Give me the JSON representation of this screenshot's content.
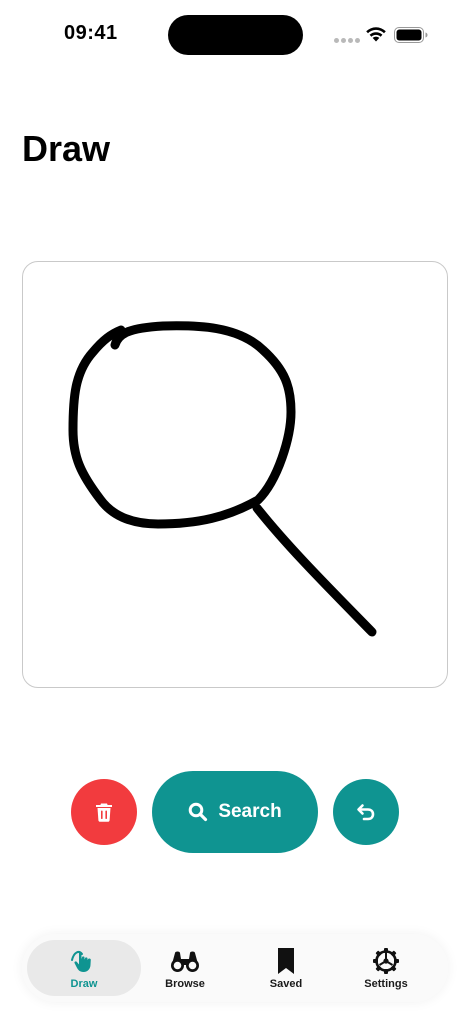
{
  "status_bar": {
    "time": "09:41"
  },
  "page": {
    "title": "Draw"
  },
  "actions": {
    "delete_icon": "trash-icon",
    "search_label": "Search",
    "search_icon": "search-icon",
    "undo_icon": "undo-icon"
  },
  "tabs": [
    {
      "label": "Draw",
      "icon": "hand-draw-icon",
      "active": true
    },
    {
      "label": "Browse",
      "icon": "binoculars-icon",
      "active": false
    },
    {
      "label": "Saved",
      "icon": "bookmark-icon",
      "active": false
    },
    {
      "label": "Settings",
      "icon": "gear-icon",
      "active": false
    }
  ],
  "colors": {
    "accent": "#0f9491",
    "danger": "#f23b3e",
    "stroke": "#000000"
  }
}
